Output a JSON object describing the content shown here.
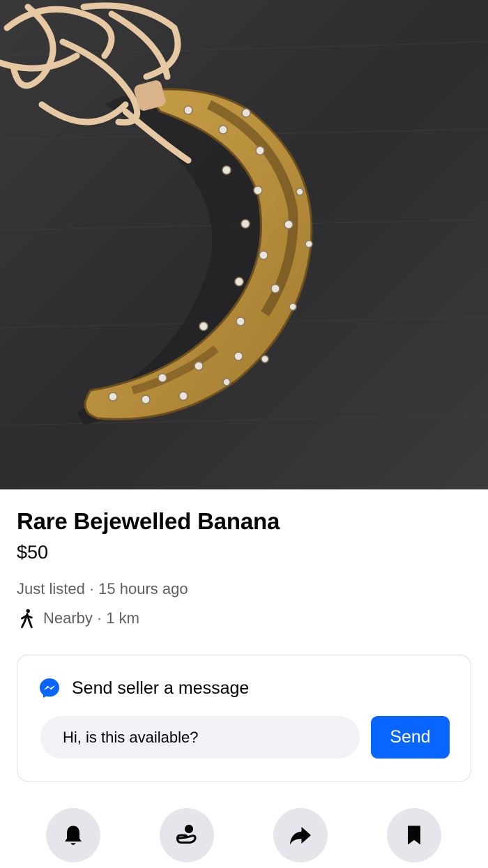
{
  "listing": {
    "title": "Rare Bejewelled Banana",
    "price": "$50",
    "listed_status": "Just listed",
    "listed_time": "15 hours ago",
    "distance_label": "Nearby",
    "distance": "1 km"
  },
  "message": {
    "heading": "Send seller a message",
    "input_value": "Hi, is this available?",
    "send_label": "Send"
  },
  "icons": {
    "walk": "walking-person-icon",
    "messenger": "messenger-icon",
    "bell": "bell-icon",
    "offer": "make-offer-icon",
    "share": "share-icon",
    "save": "bookmark-icon"
  },
  "colors": {
    "accent": "#0866ff",
    "secondary_text": "#5e5f63",
    "button_bg": "#e4e6eb",
    "input_bg": "#f0f2f5"
  }
}
